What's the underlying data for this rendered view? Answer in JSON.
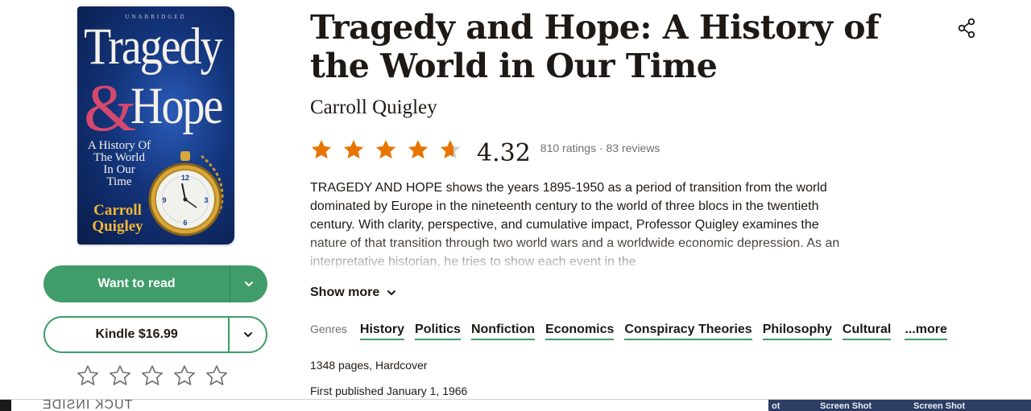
{
  "book": {
    "title": "Tragedy and Hope: A History of the World in Our Time",
    "author": "Carroll Quigley",
    "average_rating": "4.32",
    "rating_fraction": 0.66,
    "counts": "810 ratings · 83 reviews",
    "description": "TRAGEDY AND HOPE shows the years 1895-1950 as a period of transition from the world dominated by Europe in the nineteenth century to the world of three blocs in the twentieth century. With clarity, perspective, and cumulative impact, Professor Quigley examines the nature of that transition through two world wars and a worldwide economic depression. As an interpretative historian, he tries to show each event in the",
    "show_more": "Show more",
    "genres_label": "Genres",
    "genres": [
      "History",
      "Politics",
      "Nonfiction",
      "Economics",
      "Conspiracy Theories",
      "Philosophy",
      "Cultural"
    ],
    "genres_more": "...more",
    "pages": "1348 pages, Hardcover",
    "published": "First published January 1, 1966"
  },
  "cover": {
    "unabridged": "UNABRIDGED",
    "title_line1": "Tragedy",
    "ampersand": "&",
    "title_line2": "Hope",
    "subtitle": "A History Of\nThe World\nIn Our\nTime",
    "author": "Carroll\nQuigley"
  },
  "actions": {
    "want_to_read": "Want to read",
    "kindle": "Kindle $16.99",
    "user_rating": 0
  },
  "strip": {
    "mirrored_text": "TUCK INSIDE",
    "ss_fragment": "ot",
    "ss1": "Screen Shot",
    "ss2": "Screen Shot"
  },
  "colors": {
    "accent_green": "#409d69",
    "star_orange": "#e87400",
    "star_grey": "#cfcfcf",
    "text": "#1e1915"
  },
  "icons": [
    "share-icon",
    "chevron-down-icon",
    "star-icon",
    "star-outline-icon"
  ]
}
